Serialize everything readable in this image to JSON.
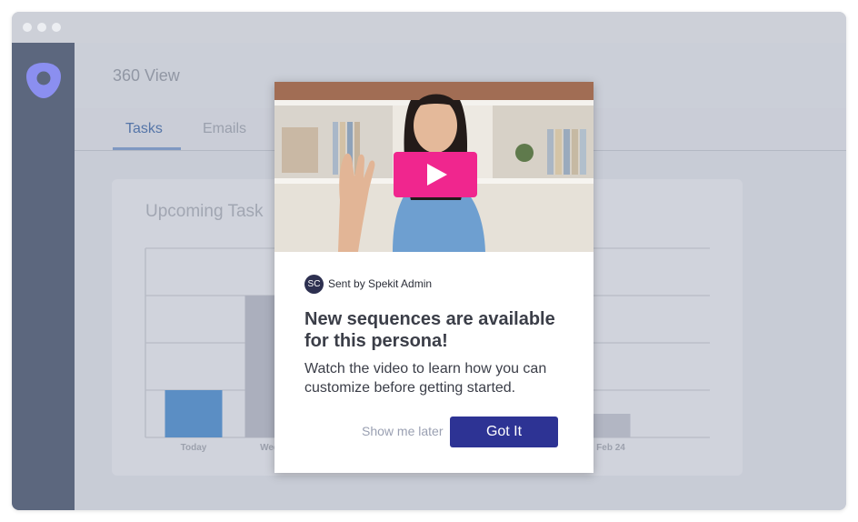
{
  "app": {
    "page_title": "360 View",
    "tabs": [
      {
        "label": "Tasks",
        "active": true
      },
      {
        "label": "Emails",
        "active": false
      }
    ]
  },
  "card": {
    "title": "Upcoming Task"
  },
  "chart_data": {
    "type": "bar",
    "categories": [
      "Today",
      "Wed F",
      "Feb 24"
    ],
    "values": [
      1,
      3,
      0.5
    ],
    "ylim": [
      0,
      4
    ],
    "grid": true
  },
  "popup": {
    "avatar_initials": "SC",
    "sender": "Sent by Spekit Admin",
    "title": "New sequences are available for this persona!",
    "body": "Watch the video to learn how you can customize before getting started.",
    "dismiss_label": "Show me later",
    "confirm_label": "Got It"
  },
  "colors": {
    "sidebar": "#5c677e",
    "accent": "#2d3394",
    "play": "#f0268e",
    "bar_highlight": "#5b8ec4"
  }
}
